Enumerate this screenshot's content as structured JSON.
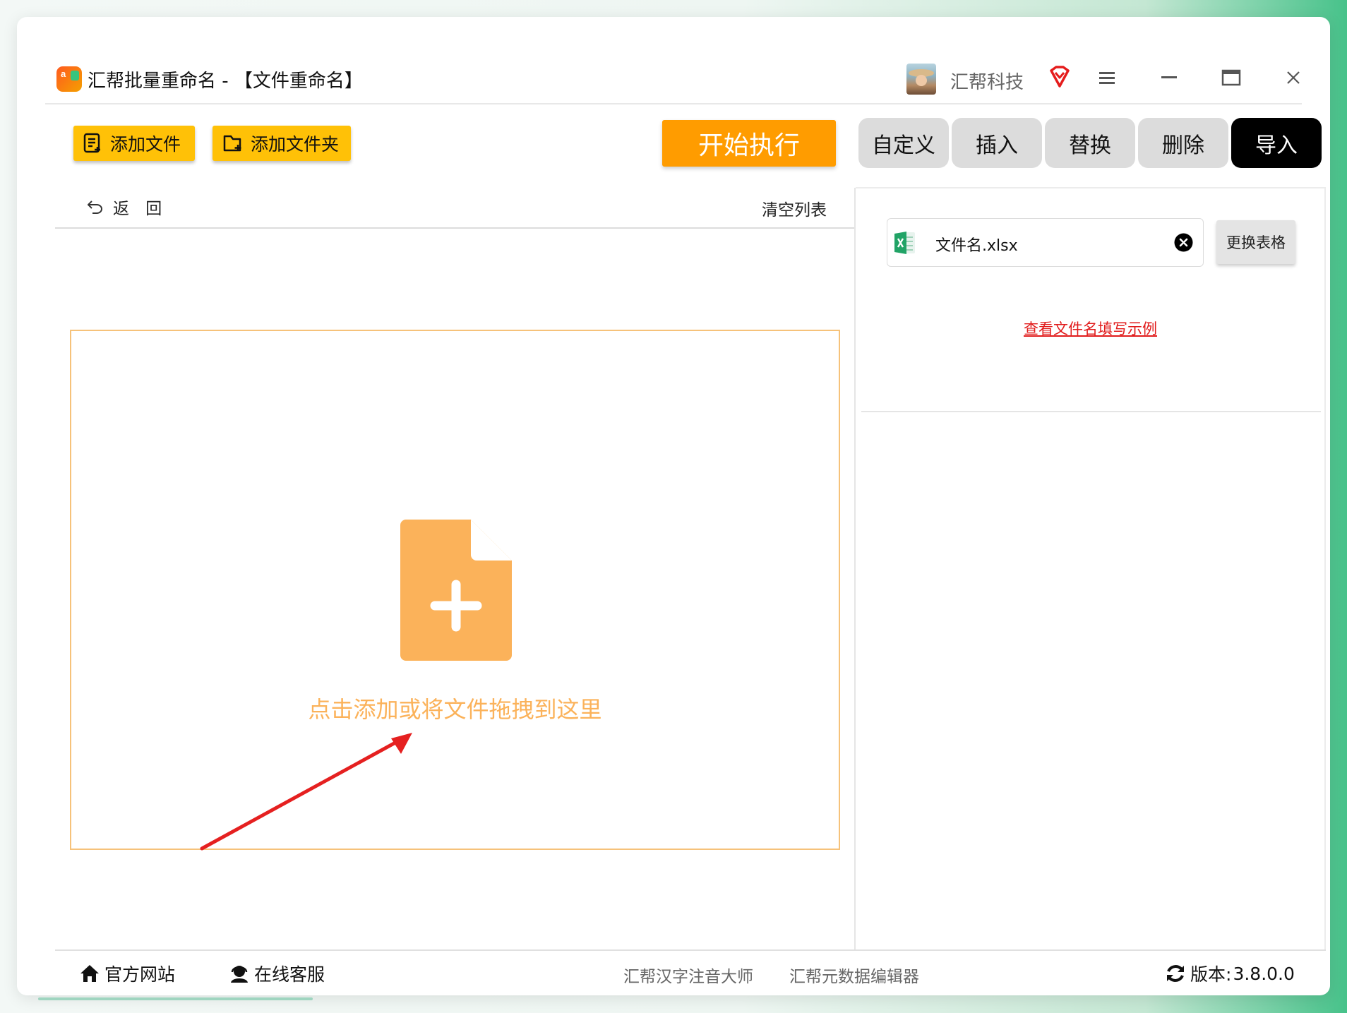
{
  "app": {
    "title": "汇帮批量重命名 - 【文件重命名】",
    "user_name": "汇帮科技"
  },
  "toolbar": {
    "add_file": "添加文件",
    "add_folder": "添加文件夹",
    "start": "开始执行"
  },
  "tabs": [
    {
      "label": "自定义",
      "active": false
    },
    {
      "label": "插入",
      "active": false
    },
    {
      "label": "替换",
      "active": false
    },
    {
      "label": "删除",
      "active": false
    },
    {
      "label": "导入",
      "active": true
    }
  ],
  "left_panel": {
    "back_label": "返 回",
    "clear_list": "清空列表",
    "drop_text": "点击添加或将文件拖拽到这里"
  },
  "right_panel": {
    "file_name": "文件名.xlsx",
    "replace_table": "更换表格",
    "example_link": "查看文件名填写示例"
  },
  "footer": {
    "official_site": "官方网站",
    "online_service": "在线客服",
    "link_pinyin": "汇帮汉字注音大师",
    "link_metadata": "汇帮元数据编辑器",
    "version_label": "版本:",
    "version_value": "3.8.0.0"
  },
  "colors": {
    "accent_yellow": "#ffc107",
    "start_orange": "#ff9c00",
    "drop_orange": "#fbb25a",
    "link_red": "#e11b1b",
    "active_tab": "#000000"
  }
}
